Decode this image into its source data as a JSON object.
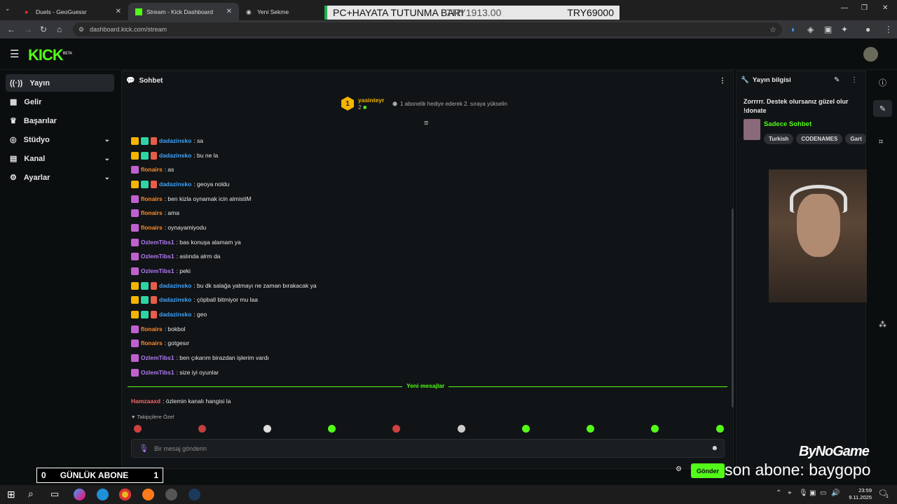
{
  "browser": {
    "tabs": [
      {
        "title": "Duels - GeoGuessr",
        "close": "✕"
      },
      {
        "title": "Stream - Kick Dashboard",
        "close": "✕"
      },
      {
        "title": "Yeni Sekme",
        "close": ""
      }
    ],
    "url": "dashboard.kick.com/stream"
  },
  "overlay": {
    "banner_title": "PC+HAYATA TUTUNMA BARI",
    "banner_current": "TRY1913.00",
    "banner_goal": "TRY69000",
    "daily_subs_label": "GÜNLÜK ABONE",
    "daily_subs_left": "0",
    "daily_subs_right": "1",
    "last_sub": "son abone: baygopo",
    "brand": "ByNoGame"
  },
  "kick": {
    "logo": "KICK",
    "logo_sup": "BETA"
  },
  "sidebar": {
    "items": [
      {
        "label": "Yayın",
        "icon": "broadcast-icon"
      },
      {
        "label": "Gelir",
        "icon": "revenue-icon"
      },
      {
        "label": "Başarılar",
        "icon": "trophy-icon"
      },
      {
        "label": "Stüdyo",
        "icon": "studio-icon"
      },
      {
        "label": "Kanal",
        "icon": "channel-icon"
      },
      {
        "label": "Ayarlar",
        "icon": "settings-icon"
      }
    ]
  },
  "chat": {
    "title": "Sohbet",
    "top_gifter": {
      "rank": "1",
      "name": "yasinteyr",
      "count": "2"
    },
    "gift_prompt": "1 abonelik hediye ederek 2. sıraya yükselin",
    "messages": [
      {
        "user": "dadazinsko",
        "text": ": sa",
        "type": "og"
      },
      {
        "user": "dadazinsko",
        "text": ": bu ne la",
        "type": "og"
      },
      {
        "user": "flonairs",
        "text": ": as",
        "type": "sub"
      },
      {
        "user": "dadazinsko",
        "text": ": geoya noldu",
        "type": "og"
      },
      {
        "user": "flonairs",
        "text": ": ben kizla oynamak icin almistiM",
        "type": "sub"
      },
      {
        "user": "flonairs",
        "text": ": ama",
        "type": "sub"
      },
      {
        "user": "flonairs",
        "text": ": oynayamiyodu",
        "type": "sub"
      },
      {
        "user": "OzlemTibs1",
        "text": ": bas konuşa alamam ya",
        "type": "sub2"
      },
      {
        "user": "OzlemTibs1",
        "text": ": aslında alrm da",
        "type": "sub2"
      },
      {
        "user": "OzlemTibs1",
        "text": ": peki",
        "type": "sub2"
      },
      {
        "user": "dadazinsko",
        "text": ": bu dk salağa yatmayı ne zaman bırakacak ya",
        "type": "og"
      },
      {
        "user": "dadazinsko",
        "text": ": çöpball bitmiyor mu laa",
        "type": "og"
      },
      {
        "user": "dadazinsko",
        "text": ": geo",
        "type": "og"
      },
      {
        "user": "flonairs",
        "text": ": bokbol",
        "type": "sub"
      },
      {
        "user": "flonairs",
        "text": ": gotgesır",
        "type": "sub"
      },
      {
        "user": "OzlemTibs1",
        "text": ": ben çıkarım birazdan işlerim vardı",
        "type": "sub2"
      },
      {
        "user": "OzlemTibs1",
        "text": ": size iyi oyunlar",
        "type": "sub2"
      }
    ],
    "new_messages_label": "Yeni mesajlar",
    "new_message": {
      "user": "Hamzaaxd",
      "text": ": özlemin kanalı hangisi la"
    },
    "followers_label": "Takipçilere Özel",
    "input_placeholder": "Bir mesaj gönderin",
    "send_label": "Gönder"
  },
  "stream_info": {
    "title": "Yayın bilgisi",
    "stream_title": "Zorrrrr. Destek olursanız güzel olur !donate",
    "category": "Sadece Sohbet",
    "tags": [
      "Turkish",
      "CODENAMES",
      "Gart"
    ]
  },
  "taskbar": {
    "time": "23:59",
    "date": "9.11.2025",
    "notifications": "1"
  },
  "colors": {
    "kick_green": "#53fc18",
    "bg": "#0b0e0f",
    "panel": "#111416"
  }
}
